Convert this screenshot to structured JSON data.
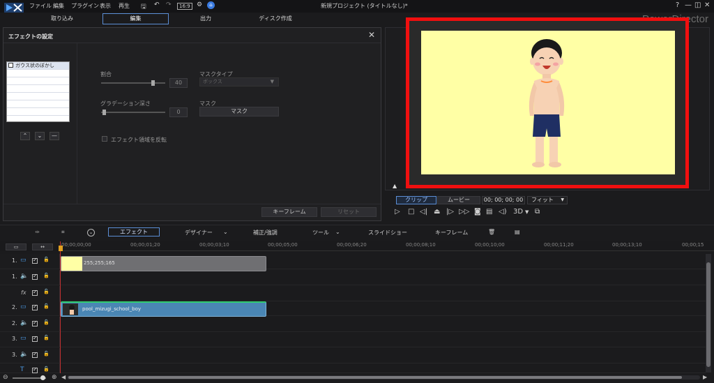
{
  "menu": [
    "ファイル",
    "編集",
    "プラグイン",
    "表示",
    "再生"
  ],
  "window_title": "新規プロジェクト (タイトルなし)*",
  "brand": "PowerDirector",
  "window_controls": [
    "?",
    "—",
    "◫",
    "✕"
  ],
  "mode_tabs": [
    "取り込み",
    "編集",
    "出力",
    "ディスク作成"
  ],
  "active_mode": "編集",
  "effect_panel": {
    "title": "エフェクトの設定",
    "effects": [
      "ガウス状のぼかし"
    ],
    "ratio_label": "割合",
    "ratio_value": "40",
    "ratio_fraction": 0.8,
    "gradation_label": "グラデーション深さ",
    "gradation_value": "0",
    "gradation_fraction": 0.0,
    "mask_type_label": "マスクタイプ",
    "mask_type_value": "ボックス",
    "mask_label": "マスク",
    "mask_button": "マスク",
    "invert_label": "エフェクト領域を反転",
    "keyframe_button": "キーフレーム",
    "reset_button": "リセット"
  },
  "preview": {
    "background_color": "#ffffa5",
    "highlight_color": "#f00f0f",
    "clip_button": "クリップ",
    "movie_button": "ムービー",
    "timecode": "00; 00; 00; 00",
    "fit_label": "フィット",
    "mode_3d": "3D"
  },
  "timeline_toolbar": {
    "effect": "エフェクト",
    "designer": "デザイナー",
    "correction": "補正/強調",
    "tools": "ツール",
    "slideshow": "スライドショー",
    "keyframe": "キーフレーム"
  },
  "ruler_labels": [
    "00;00;00;00",
    "00;00;01;20",
    "00;00;03;10",
    "00;00;05;00",
    "00;00;06;20",
    "00;00;08;10",
    "00;00;10;00",
    "00;00;11;20",
    "00;00;13;10",
    "00;00;15"
  ],
  "tracks": [
    {
      "num": "1.",
      "icon": "video-track-icon",
      "glyph": "▭"
    },
    {
      "num": "1.",
      "icon": "audio-track-icon",
      "glyph": "🔈"
    },
    {
      "num": "",
      "icon": "fx-track-icon",
      "glyph": "fx"
    },
    {
      "num": "2.",
      "icon": "video-track-icon",
      "glyph": "▭"
    },
    {
      "num": "2.",
      "icon": "audio-track-icon",
      "glyph": "🔈"
    },
    {
      "num": "3.",
      "icon": "video-track-icon",
      "glyph": "▭"
    },
    {
      "num": "3.",
      "icon": "audio-track-icon",
      "glyph": "🔈"
    },
    {
      "num": "",
      "icon": "title-track-icon",
      "glyph": "T"
    }
  ],
  "clips": {
    "color_clip_label": "255;255;165",
    "color_clip_color": "#ffffa5",
    "video_clip_label": "pool_mizugi_school_boy"
  }
}
